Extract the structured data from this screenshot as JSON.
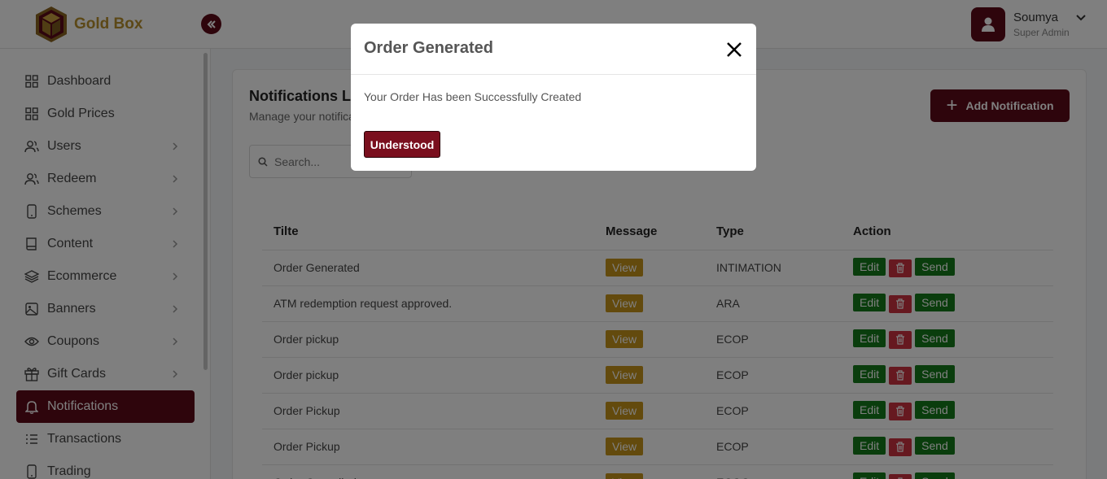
{
  "header": {
    "brand": "Gold Box",
    "user_name": "Soumya",
    "user_role": "Super Admin"
  },
  "sidebar": {
    "items": [
      {
        "label": "Dashboard",
        "icon": "grid-icon",
        "has_chevron": false
      },
      {
        "label": "Gold Prices",
        "icon": "grid-icon",
        "has_chevron": false
      },
      {
        "label": "Users",
        "icon": "users-icon",
        "has_chevron": true
      },
      {
        "label": "Redeem",
        "icon": "users-icon",
        "has_chevron": true
      },
      {
        "label": "Schemes",
        "icon": "phone-icon",
        "has_chevron": true
      },
      {
        "label": "Content",
        "icon": "book-icon",
        "has_chevron": true
      },
      {
        "label": "Ecommerce",
        "icon": "layers-icon",
        "has_chevron": true
      },
      {
        "label": "Banners",
        "icon": "image-icon",
        "has_chevron": true
      },
      {
        "label": "Coupons",
        "icon": "eye-icon",
        "has_chevron": true
      },
      {
        "label": "Gift Cards",
        "icon": "gift-icon",
        "has_chevron": true
      },
      {
        "label": "Notifications",
        "icon": "bell-icon",
        "has_chevron": false,
        "active": true
      },
      {
        "label": "Transactions",
        "icon": "list-icon",
        "has_chevron": false
      },
      {
        "label": "Trading",
        "icon": "phone-icon",
        "has_chevron": false
      }
    ]
  },
  "main": {
    "title": "Notifications Li",
    "subtitle": "Manage your notifica",
    "add_button": "Add Notification",
    "search_placeholder": "Search...",
    "table": {
      "headers": [
        "Tilte",
        "Message",
        "Type",
        "Action"
      ],
      "view_label": "View",
      "edit_label": "Edit",
      "send_label": "Send",
      "rows": [
        {
          "title": "Order Generated",
          "type": "INTIMATION"
        },
        {
          "title": "ATM redemption request approved.",
          "type": "ARA"
        },
        {
          "title": "Order pickup",
          "type": "ECOP"
        },
        {
          "title": "Order pickup",
          "type": "ECOP"
        },
        {
          "title": "Order Pickup",
          "type": "ECOP"
        },
        {
          "title": "Order Pickup",
          "type": "ECOP"
        },
        {
          "title": "Order Cancelled",
          "type": "ECOC"
        }
      ]
    }
  },
  "modal": {
    "title": "Order Generated",
    "message": "Your Order Has been Successfully Created",
    "button": "Understood"
  },
  "colors": {
    "brand_maroon": "#5c0a18",
    "gold": "#b8912f",
    "view": "#c7951a",
    "edit_send": "#157a1a",
    "delete": "#cc3340"
  }
}
